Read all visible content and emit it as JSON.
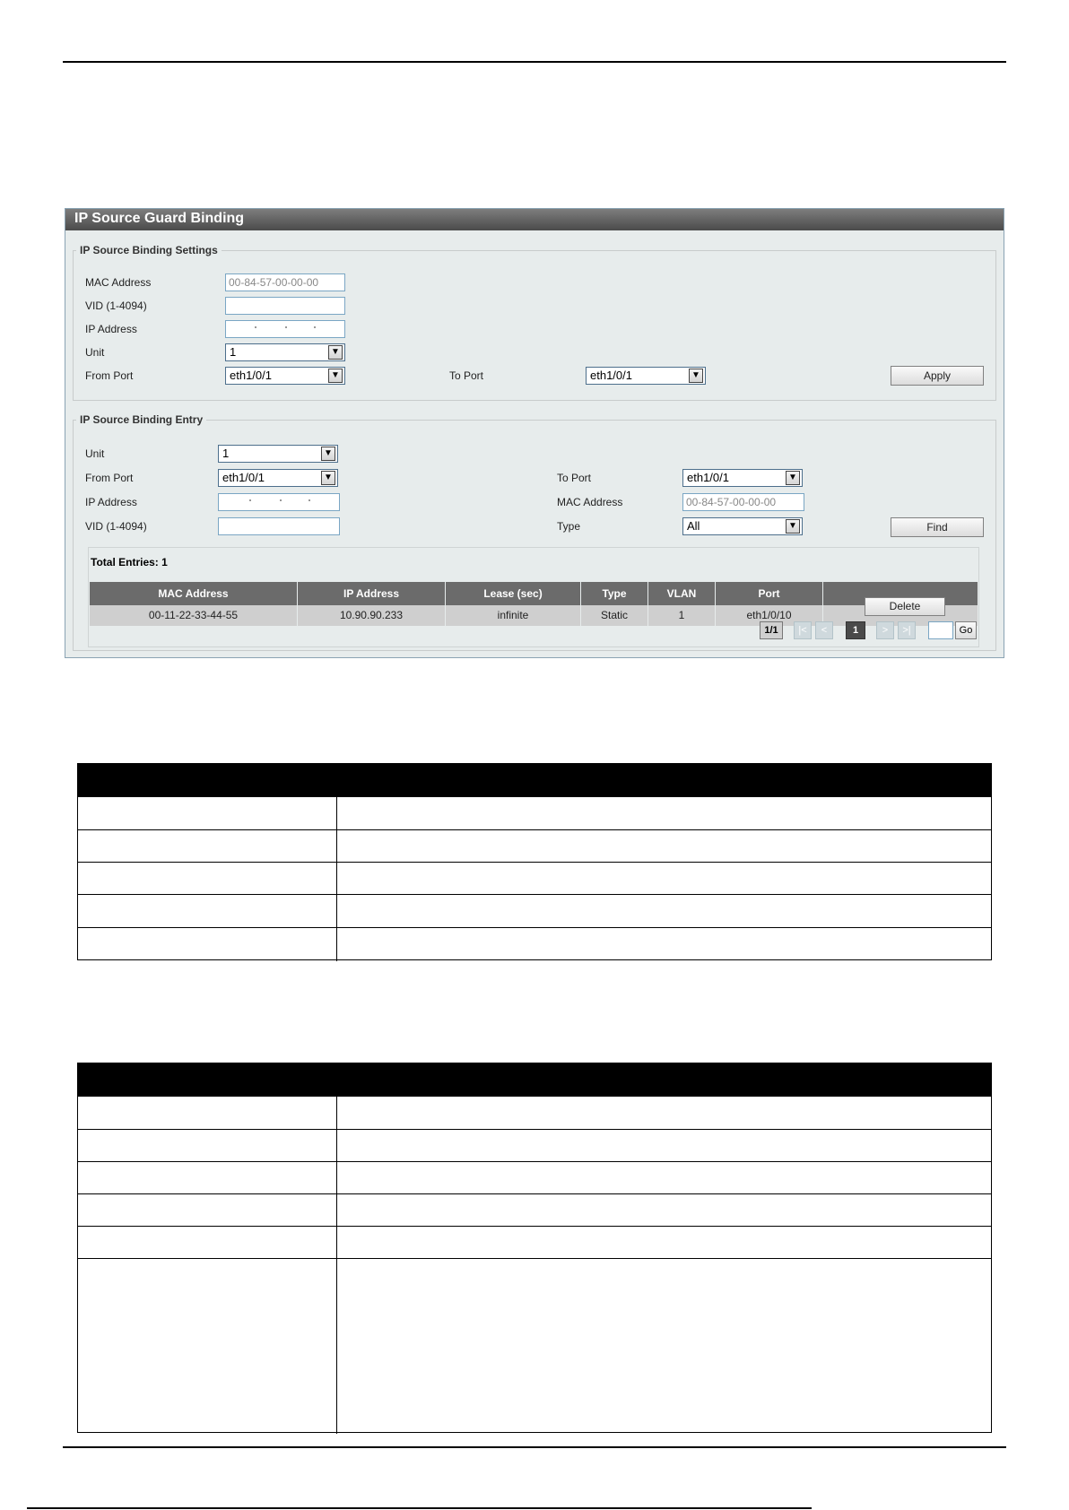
{
  "panel": {
    "title": "IP Source Guard Binding",
    "settings": {
      "legend": "IP Source Binding Settings",
      "mac_label": "MAC Address",
      "mac_value": "00-84-57-00-00-00",
      "vid_label": "VID (1-4094)",
      "ip_label": "IP Address",
      "unit_label": "Unit",
      "unit_value": "1",
      "from_port_label": "From Port",
      "from_port_value": "eth1/0/1",
      "to_port_label": "To Port",
      "to_port_value": "eth1/0/1",
      "apply_label": "Apply"
    },
    "entry": {
      "legend": "IP Source Binding Entry",
      "unit_label": "Unit",
      "unit_value": "1",
      "from_port_label": "From Port",
      "from_port_value": "eth1/0/1",
      "to_port_label": "To Port",
      "to_port_value": "eth1/0/1",
      "ip_label": "IP Address",
      "mac_label": "MAC Address",
      "mac_value": "00-84-57-00-00-00",
      "vid_label": "VID (1-4094)",
      "type_label": "Type",
      "type_value": "All",
      "find_label": "Find"
    },
    "results": {
      "total": "Total Entries: 1",
      "columns": [
        "MAC Address",
        "IP Address",
        "Lease (sec)",
        "Type",
        "VLAN",
        "Port"
      ],
      "row": [
        "00-11-22-33-44-55",
        "10.90.90.233",
        "infinite",
        "Static",
        "1",
        "eth1/0/10"
      ],
      "delete_label": "Delete",
      "page_info": "1/1",
      "first": "|<",
      "prev": "<",
      "current_page": "1",
      "next": ">",
      "last": ">|",
      "go_label": "Go"
    }
  },
  "icons": {
    "dropdown_arrow": "chevron-down-icon"
  }
}
